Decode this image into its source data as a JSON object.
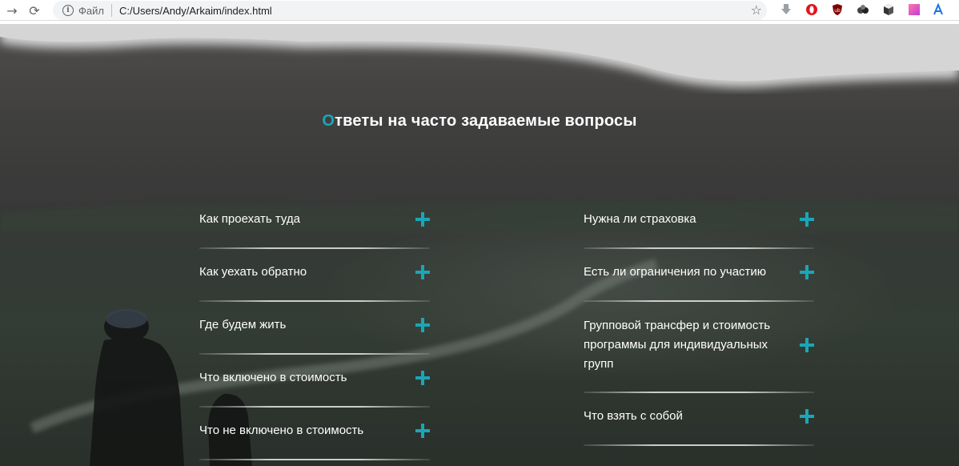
{
  "browser": {
    "scheme_label": "Файл",
    "url": "C:/Users/Andy/Arkaim/index.html"
  },
  "icons": {
    "back": "arrow-right-icon",
    "reload": "reload-icon",
    "info": "info-icon",
    "bookmark": "star-icon"
  },
  "colors": {
    "accent": "#1aa6b7"
  },
  "page": {
    "title_first_letter": "О",
    "title_rest": "тветы на часто задаваемые вопросы"
  },
  "faq": {
    "left": [
      "Как проехать туда",
      "Как уехать обратно",
      "Где будем жить",
      "Что включено в стоимость",
      "Что не включено в стоимость"
    ],
    "right": [
      "Нужна ли страховка",
      "Есть ли ограничения по участию",
      "Групповой трансфер и стоимость программы для индивидуальных групп",
      "Что взять с собой"
    ]
  }
}
